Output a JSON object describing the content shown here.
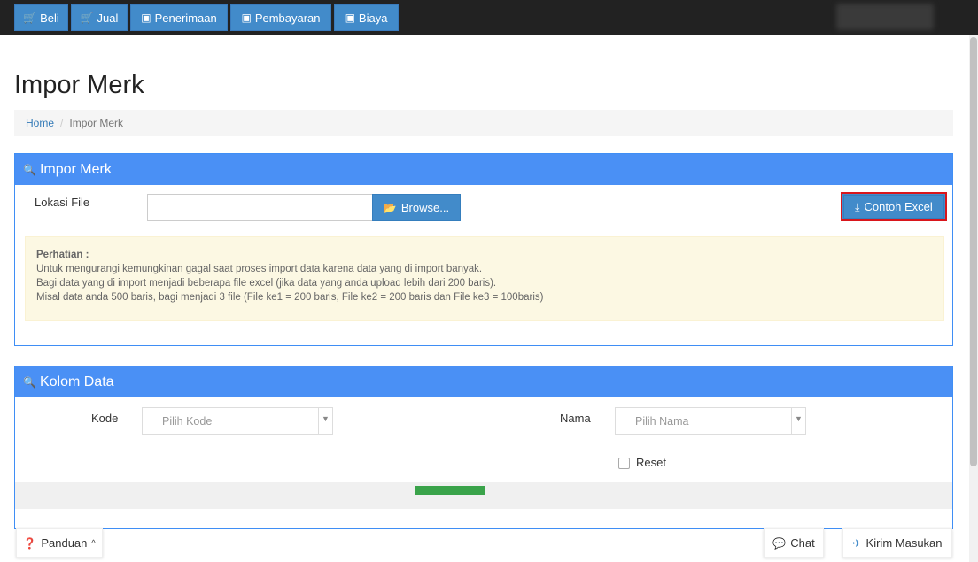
{
  "topbar": {
    "buttons": [
      {
        "label": "Beli",
        "icon": "cart-icon"
      },
      {
        "label": "Jual",
        "icon": "cart-icon"
      },
      {
        "label": "Penerimaan",
        "icon": "money-icon"
      },
      {
        "label": "Pembayaran",
        "icon": "money-icon"
      },
      {
        "label": "Biaya",
        "icon": "money-icon"
      }
    ]
  },
  "page": {
    "title": "Impor Merk"
  },
  "breadcrumb": {
    "home": "Home",
    "separator": "/",
    "current": "Impor Merk"
  },
  "impor_panel": {
    "heading": "Impor Merk",
    "file_label": "Lokasi File",
    "file_value": "",
    "browse_label": "Browse...",
    "excel_label": "Contoh Excel",
    "alert": {
      "title": "Perhatian :",
      "lines": [
        "Untuk mengurangi kemungkinan gagal saat proses import data karena data yang di import banyak.",
        "Bagi data yang di import menjadi beberapa file excel (jika data yang anda upload lebih dari 200 baris).",
        "Misal data anda 500 baris, bagi menjadi 3 file (File ke1 = 200 baris, File ke2 = 200 baris dan File ke3 = 100baris)"
      ]
    }
  },
  "kolom_panel": {
    "heading": "Kolom Data",
    "kode_label": "Kode",
    "kode_placeholder": "Pilih Kode",
    "nama_label": "Nama",
    "nama_placeholder": "Pilih Nama",
    "reset_label": "Reset"
  },
  "bottom": {
    "panduan_label": "Panduan",
    "chat_label": "Chat",
    "kirim_label": "Kirim Masukan"
  },
  "colors": {
    "topbar_bg": "#222222",
    "primary": "#428bca",
    "panel_heading": "#4a90f5",
    "alert_bg": "#fcf8e3",
    "highlight_border": "#d9161c"
  }
}
